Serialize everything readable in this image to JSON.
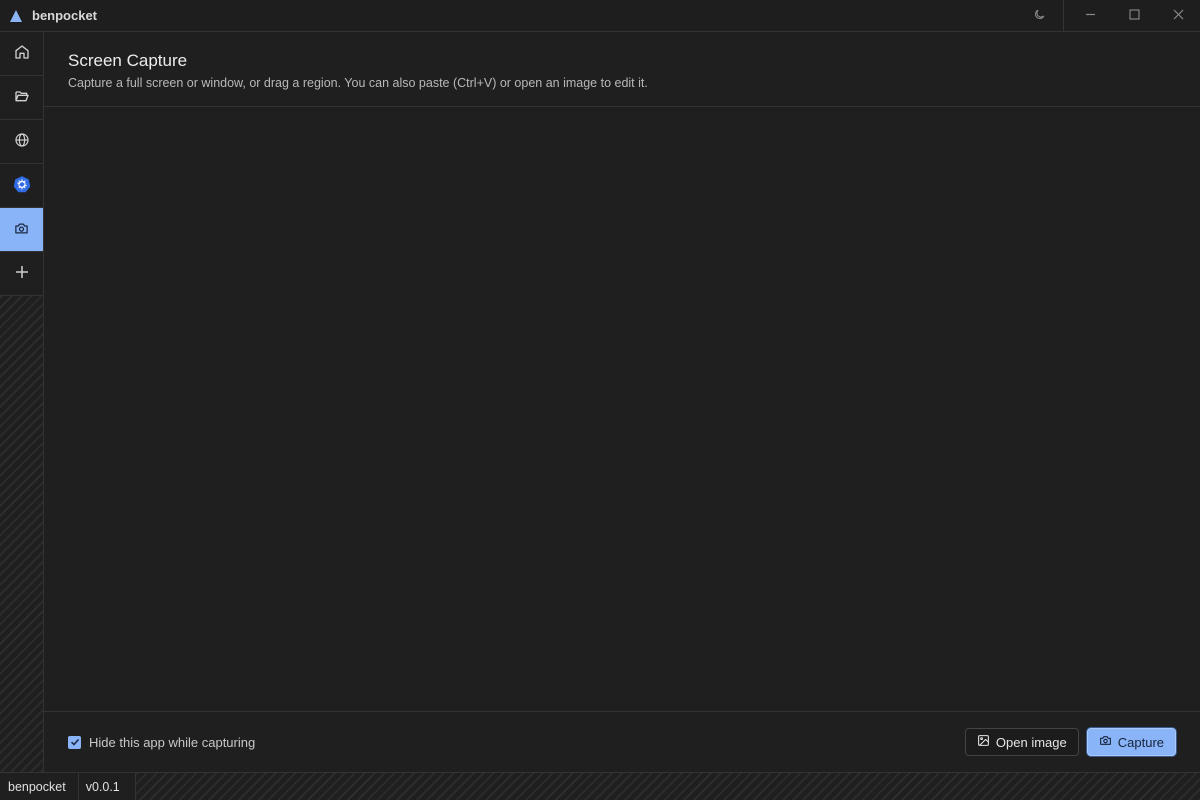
{
  "window": {
    "title": "benpocket",
    "logo_icon": "triangle-logo-icon",
    "theme_icon": "moon-icon",
    "controls": [
      "minimize-icon",
      "maximize-icon",
      "close-icon"
    ]
  },
  "sidebar": {
    "items": [
      {
        "name": "home",
        "icon": "home-icon",
        "active": false
      },
      {
        "name": "files",
        "icon": "folder-icon",
        "active": false
      },
      {
        "name": "network",
        "icon": "globe-icon",
        "active": false
      },
      {
        "name": "kubernetes",
        "icon": "kubernetes-icon",
        "active": false
      },
      {
        "name": "screen-capture",
        "icon": "camera-icon",
        "active": true
      },
      {
        "name": "add",
        "icon": "plus-icon",
        "active": false
      }
    ]
  },
  "main": {
    "title": "Screen Capture",
    "description": "Capture a full screen or window, or drag a region. You can also paste (Ctrl+V) or open an image to edit it."
  },
  "footer": {
    "hide_app_label": "Hide this app while capturing",
    "hide_app_checked": true,
    "open_image_label": "Open image",
    "capture_label": "Capture"
  },
  "status": {
    "app_name": "benpocket",
    "version": "v0.0.1"
  },
  "colors": {
    "accent": "#8ab4f8",
    "background": "#1f1f1f",
    "border": "#333333"
  }
}
